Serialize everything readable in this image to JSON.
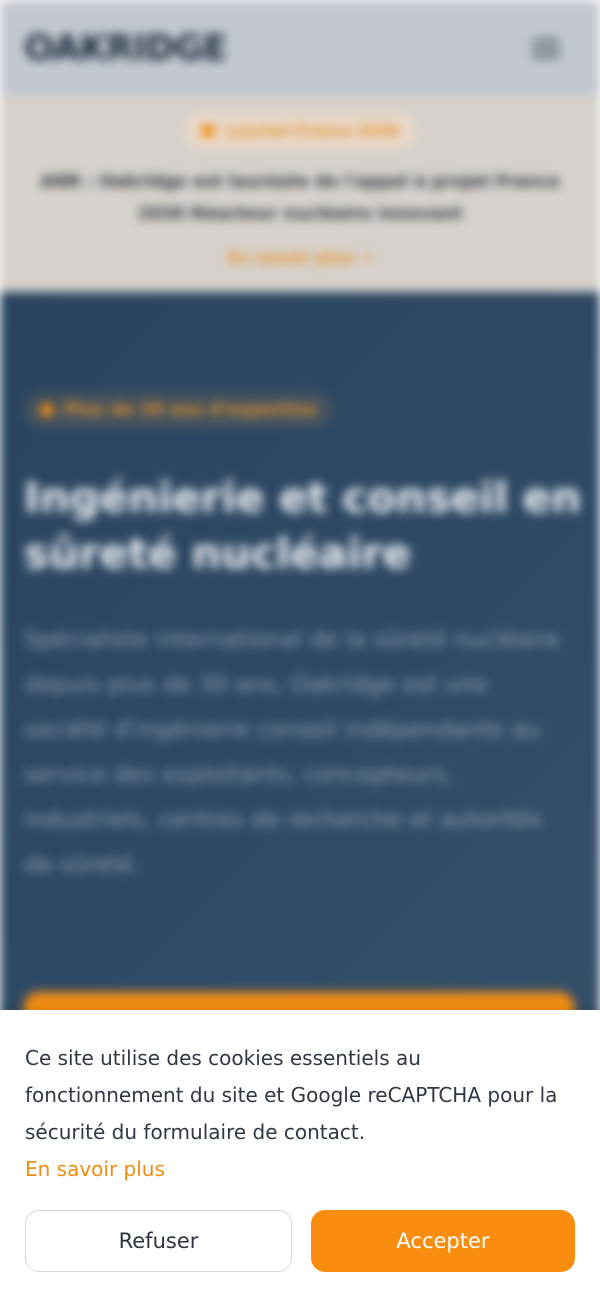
{
  "header": {
    "logo_text": "OAKRIDGE",
    "menu_icon": "hamburger-menu-icon"
  },
  "announcement": {
    "badge": "Lauréat France 2030",
    "text": "ANR : Oakridge est lauréate de l'appel à projet France 2030 Réacteur nucléaire innovant",
    "link": "En savoir plus →"
  },
  "hero": {
    "badge": "Plus de 30 ans d'expertise",
    "title": "Ingénierie et conseil en sûreté nucléaire",
    "body": "Spécialiste international de la sûreté nucléaire depuis plus de 30 ans, Oakridge est une société d'ingénierie conseil indépendante au service des exploitants, concepteurs, industriels, centres de recherche et autorités de sûreté."
  },
  "cookie_banner": {
    "text": "Ce site utilise des cookies essentiels au fonctionnement du site et Google reCAPTCHA pour la sécurité du formulaire de contact.",
    "link": "En savoir plus",
    "refuse_label": "Refuser",
    "accept_label": "Accepter",
    "accent_color": "#f98d0f"
  },
  "colors": {
    "header_bg": "#c3c8cf",
    "announcement_bg": "#d6d1cc",
    "hero_bg": "#2f4a66",
    "accent": "#f38d12"
  }
}
